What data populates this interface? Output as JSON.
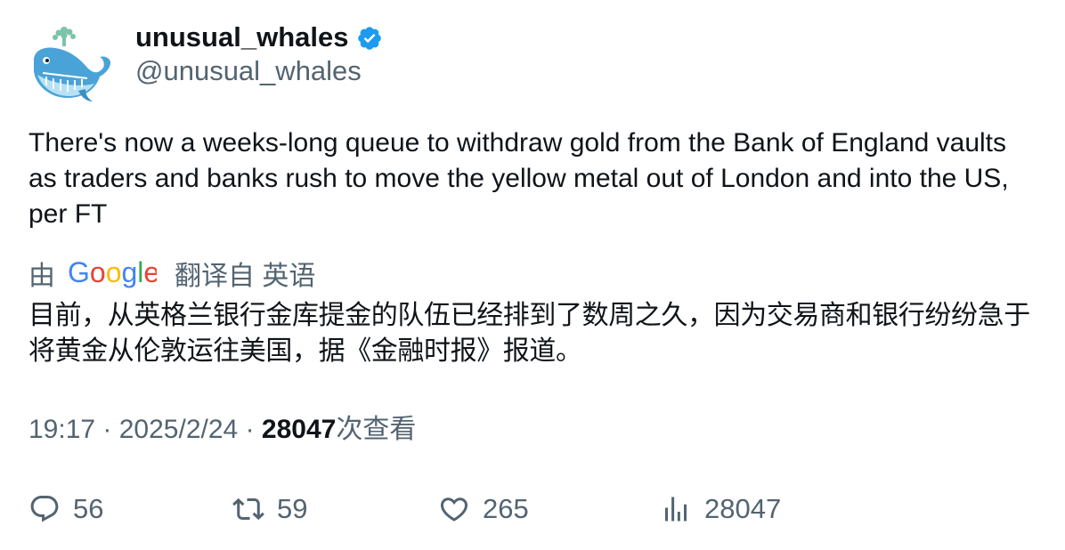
{
  "author": {
    "display_name": "unusual_whales",
    "handle": "@unusual_whales",
    "verified": true,
    "avatar_icon": "whale-logo-icon"
  },
  "tweet": {
    "text": "There's now a weeks-long queue to withdraw gold from the Bank of England vaults as traders and banks rush to move the yellow metal out of London and into the US, per FT"
  },
  "translation": {
    "prefix": "由",
    "provider_logo": "Google",
    "suffix": "翻译自 英语",
    "text": "目前，从英格兰银行金库提金的队伍已经排到了数周之久，因为交易商和银行纷纷急于将黄金从伦敦运往美国，据《金融时报》报道。"
  },
  "meta": {
    "time": "19:17",
    "separator": "·",
    "date": "2025/2/24",
    "views_count": "28047",
    "views_label": "次查看"
  },
  "actions": {
    "replies": "56",
    "retweets": "59",
    "likes": "265",
    "views": "28047"
  },
  "colors": {
    "text_primary": "#0f1419",
    "text_secondary": "#536471",
    "verified_blue": "#1d9bf0"
  }
}
